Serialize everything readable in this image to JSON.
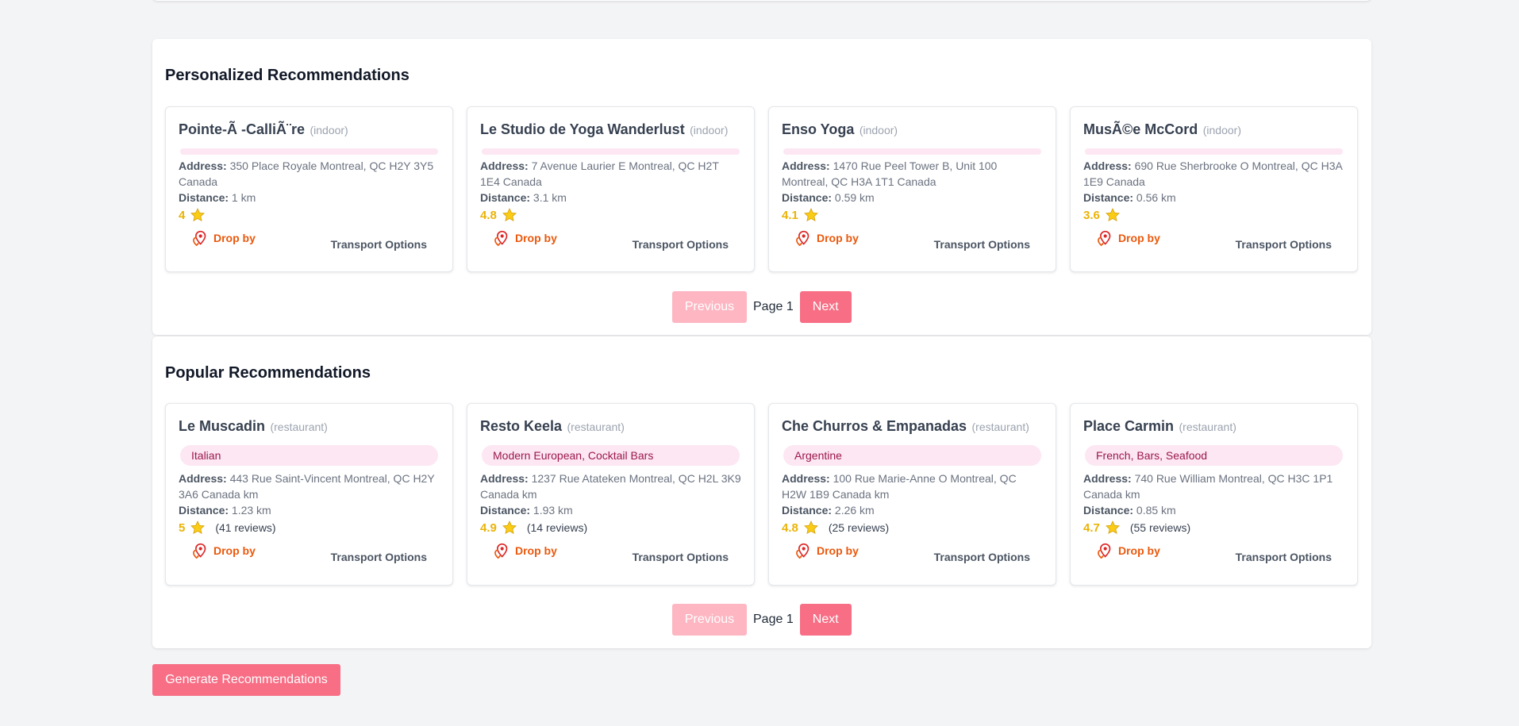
{
  "personalized": {
    "title": "Personalized Recommendations",
    "cards": [
      {
        "name": "Pointe-Ã -CalliÃ¨re",
        "type": "(indoor)",
        "address": "350 Place Royale Montreal, QC H2Y 3Y5 Canada",
        "distance": "1 km",
        "rating": "4"
      },
      {
        "name": "Le Studio de Yoga Wanderlust",
        "type": "(indoor)",
        "address": "7 Avenue Laurier E Montreal, QC H2T 1E4 Canada",
        "distance": "3.1 km",
        "rating": "4.8"
      },
      {
        "name": "Enso Yoga",
        "type": "(indoor)",
        "address": "1470 Rue Peel Tower B, Unit 100 Montreal, QC H3A 1T1 Canada",
        "distance": "0.59 km",
        "rating": "4.1"
      },
      {
        "name": "MusÃ©e McCord",
        "type": "(indoor)",
        "address": "690 Rue Sherbrooke O Montreal, QC H3A 1E9 Canada",
        "distance": "0.56 km",
        "rating": "3.6"
      }
    ],
    "pager": {
      "prev": "Previous",
      "page": "Page 1",
      "next": "Next"
    }
  },
  "popular": {
    "title": "Popular Recommendations",
    "cards": [
      {
        "name": "Le Muscadin",
        "type": "(restaurant)",
        "tags": "Italian",
        "address": "443 Rue Saint-Vincent Montreal, QC H2Y 3A6 Canada km",
        "distance": "1.23 km",
        "rating": "5",
        "reviews": "(41 reviews)"
      },
      {
        "name": "Resto Keela",
        "type": "(restaurant)",
        "tags": "Modern European, Cocktail Bars",
        "address": "1237 Rue Atateken Montreal, QC H2L 3K9 Canada km",
        "distance": "1.93 km",
        "rating": "4.9",
        "reviews": "(14 reviews)"
      },
      {
        "name": "Che Churros & Empanadas",
        "type": "(restaurant)",
        "tags": "Argentine",
        "address": "100 Rue Marie-Anne O Montreal, QC H2W 1B9 Canada km",
        "distance": "2.26 km",
        "rating": "4.8",
        "reviews": "(25 reviews)"
      },
      {
        "name": "Place Carmin",
        "type": "(restaurant)",
        "tags": "French, Bars, Seafood",
        "address": "740 Rue William Montreal, QC H3C 1P1 Canada km",
        "distance": "0.85 km",
        "rating": "4.7",
        "reviews": "(55 reviews)"
      }
    ],
    "pager": {
      "prev": "Previous",
      "page": "Page 1",
      "next": "Next"
    }
  },
  "labels": {
    "address": "Address:",
    "distance": "Distance:",
    "drop_by": "Drop by",
    "transport": "Transport Options"
  },
  "generate_button": "Generate Recommendations",
  "icons": {
    "rating": "star-icon",
    "drop_by": "map-pin-icon"
  },
  "colors": {
    "accent": "#f76e85",
    "accent_disabled": "#fdb6c2",
    "rating": "#eab308",
    "drop_by": "#ea580c",
    "tag_bg": "#fce7f3"
  }
}
